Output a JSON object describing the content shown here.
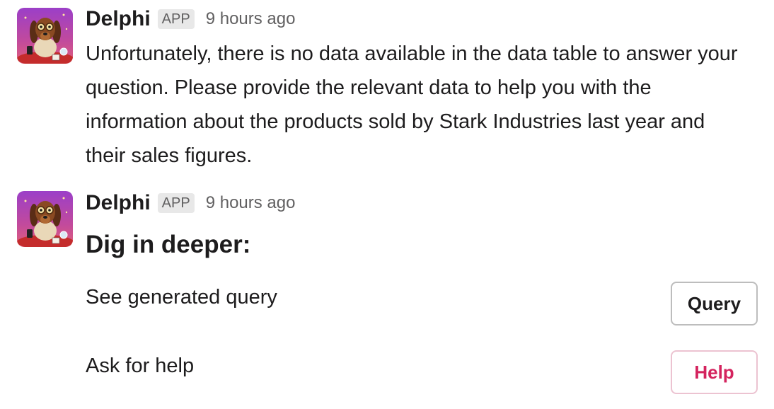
{
  "colors": {
    "help_accent": "#d4235e",
    "badge_bg": "#e8e8e8",
    "muted_text": "#616061"
  },
  "messages": [
    {
      "sender": "Delphi",
      "badge": "APP",
      "time": "9 hours ago",
      "avatar_icon": "dachshund-fortune-teller-avatar",
      "text": "Unfortunately, there is no data available in the data table to answer your question. Please provide the relevant data to help you with the information about the products sold by Stark Industries last year and their sales figures."
    },
    {
      "sender": "Delphi",
      "badge": "APP",
      "time": "9 hours ago",
      "avatar_icon": "dachshund-fortune-teller-avatar",
      "section_title": "Dig in deeper:",
      "actions": [
        {
          "label": "See generated query",
          "button": "Query"
        },
        {
          "label": "Ask for help",
          "button": "Help"
        }
      ]
    }
  ]
}
